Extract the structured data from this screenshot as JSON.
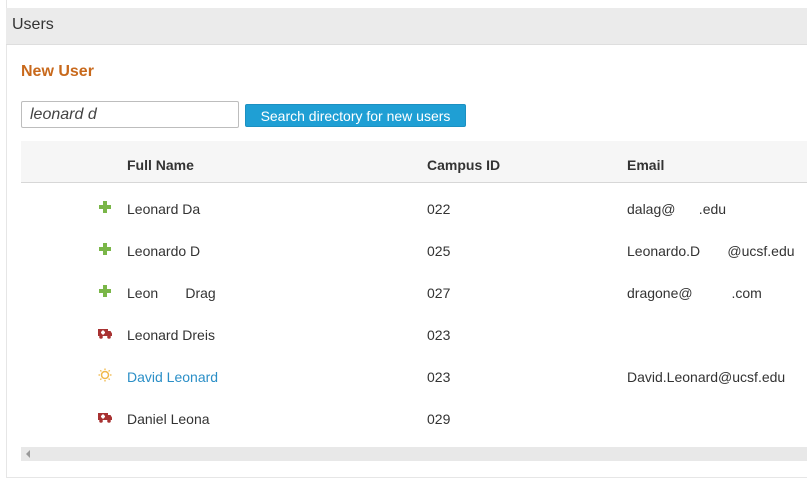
{
  "panel": {
    "title": "Users"
  },
  "section": {
    "title": "New User"
  },
  "search": {
    "value": "leonard d",
    "button_label": "Search directory for new users"
  },
  "table": {
    "columns": [
      "Full Name",
      "Campus ID",
      "Email"
    ],
    "rows": [
      {
        "icon": "plus-icon",
        "name": "Leonard Da",
        "campus_id": "022",
        "email": "dalag@      .edu",
        "is_link": false
      },
      {
        "icon": "plus-icon",
        "name": "Leonardo D",
        "campus_id": "025",
        "email": "Leonardo.D       @ucsf.edu",
        "is_link": false
      },
      {
        "icon": "plus-icon",
        "name": "Leon       Drag",
        "campus_id": "027",
        "email": "dragone@          .com",
        "is_link": false
      },
      {
        "icon": "ambulance-icon",
        "name": "Leonard Dreis",
        "campus_id": "023",
        "email": "",
        "is_link": false
      },
      {
        "icon": "sun-icon",
        "name": "David Leonard",
        "campus_id": "023",
        "email": "David.Leonard@ucsf.edu",
        "is_link": true
      },
      {
        "icon": "ambulance-icon",
        "name": "Daniel Leona",
        "campus_id": "029",
        "email": "",
        "is_link": false
      }
    ]
  },
  "colors": {
    "accent": "#c8691c",
    "button": "#1f9fd4",
    "plus": "#7ab648",
    "ambulance": "#a83232",
    "sun": "#f0b84a",
    "link": "#2b8fc7"
  }
}
